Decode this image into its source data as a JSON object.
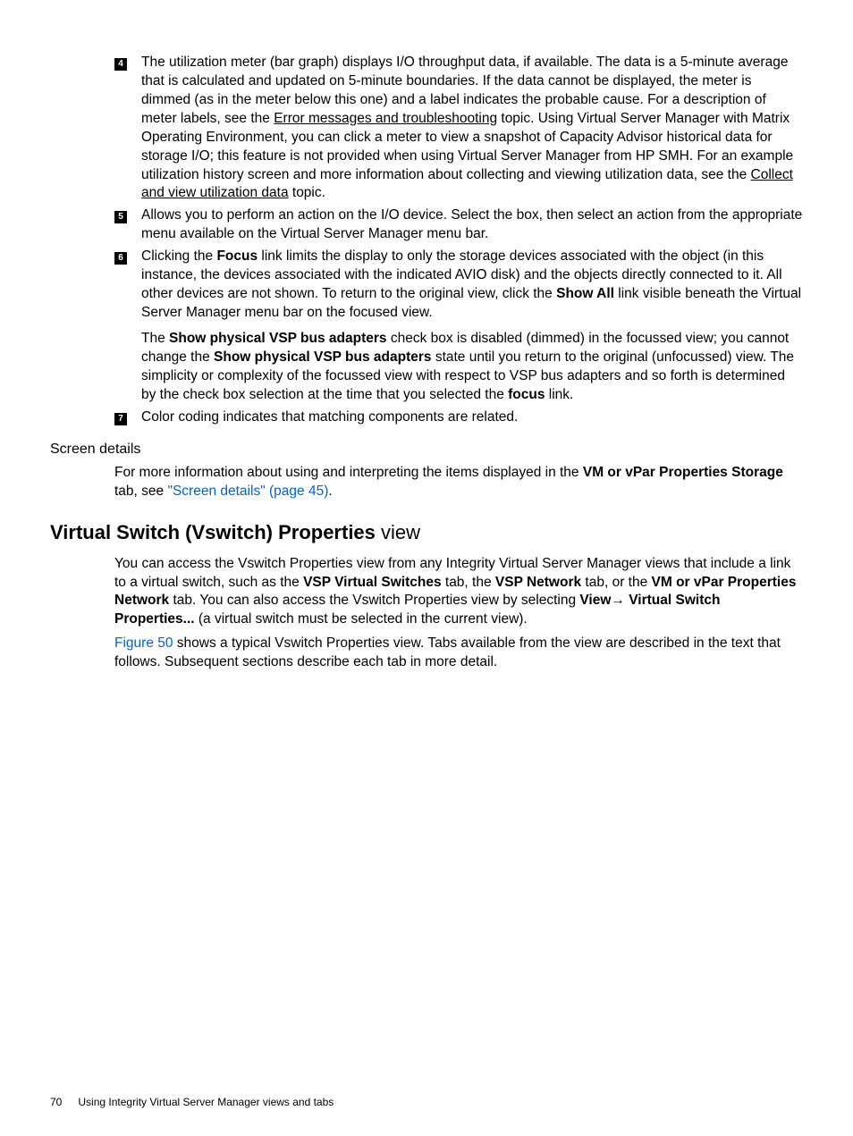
{
  "items": {
    "n4": "4",
    "n5": "5",
    "n6": "6",
    "n7": "7",
    "t4a": "The utilization meter (bar graph) displays I/O throughput data, if available. The data is a 5-minute average that is calculated and updated on 5-minute boundaries. If the data cannot be displayed, the meter is dimmed (as in the meter below this one) and a label indicates the probable cause. For a description of meter labels, see the ",
    "t4link1": "Error messages and troubleshooting",
    "t4b": " topic. Using Virtual Server Manager with Matrix Operating Environment, you can click a meter to view a snapshot of Capacity Advisor historical data for storage I/O; this feature is not provided when using Virtual Server Manager from HP SMH. For an example utilization history screen and more information about collecting and viewing utilization data, see the ",
    "t4link2": "Collect and view utilization data",
    "t4c": " topic.",
    "t5": "Allows you to perform an action on the I/O device. Select the box, then select an action from the appropriate menu available on the Virtual Server Manager menu bar.",
    "t6a": "Clicking the ",
    "t6b1": "Focus",
    "t6b": " link limits the display to only the storage devices associated with the object (in this instance, the devices associated with the indicated AVIO disk) and the objects directly connected to it. All other devices are not shown. To return to the original view, click the ",
    "t6b2": "Show All",
    "t6c": " link visible beneath the Virtual Server Manager menu bar on the focused view.",
    "t6p2a": "The ",
    "t6p2b1": "Show physical VSP bus adapters",
    "t6p2b": " check box is disabled (dimmed) in the focussed view; you cannot change the ",
    "t6p2b2": "Show physical VSP bus adapters",
    "t6p2c": " state until you return to the original (unfocussed) view. The simplicity or complexity of the focussed view with respect to VSP bus adapters and so forth is determined by the check box selection at the time that you selected the ",
    "t6p2b3": "focus",
    "t6p2d": " link.",
    "t7": "Color coding indicates that matching components are related."
  },
  "screendetails": {
    "heading": "Screen details",
    "p1a": "For more information about using and interpreting the items displayed in the ",
    "p1b1": "VM or vPar Properties Storage",
    "p1b": " tab, see ",
    "p1link": "\"Screen details\" (page 45)",
    "p1c": "."
  },
  "section": {
    "h_bold": "Virtual Switch (Vswitch) Properties",
    "h_rest": " view",
    "p1a": "You can access the Vswitch Properties view from any Integrity Virtual Server Manager views that include a link to a virtual switch, such as the ",
    "p1b1": "VSP Virtual Switches",
    "p1b": " tab, the ",
    "p1b2": "VSP Network",
    "p1c": " tab, or the ",
    "p1b3": "VM or vPar Properties Network",
    "p1d": " tab. You can also access the Vswitch Properties view by selecting ",
    "p1b4": "View",
    "arrow": "→ ",
    "p1b5": "Virtual Switch Properties...",
    "p1e": " (a virtual switch must be selected in the current view).",
    "p2link": "Figure 50",
    "p2a": " shows a typical Vswitch Properties view. Tabs available from the view are described in the text that follows. Subsequent sections describe each tab in more detail."
  },
  "footer": {
    "page": "70",
    "text": "Using Integrity Virtual Server Manager views and tabs"
  }
}
